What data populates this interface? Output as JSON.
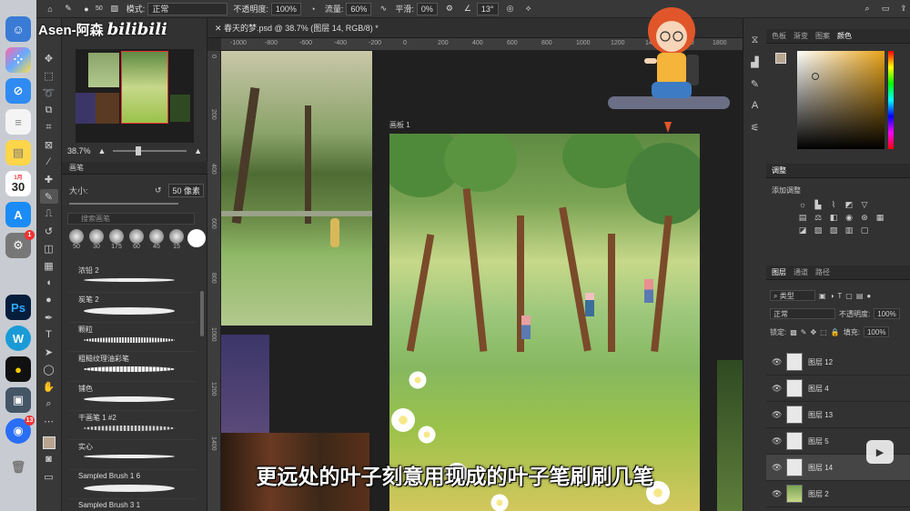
{
  "watermark": {
    "name": "Asen-阿森",
    "logo": "bilibili"
  },
  "options_bar": {
    "mode_label": "模式:",
    "mode_value": "正常",
    "opacity_label": "不透明度:",
    "opacity_value": "100%",
    "flow_label": "流量:",
    "flow_value": "60%",
    "smooth_label": "平滑:",
    "smooth_value": "0%",
    "angle_value": "13°",
    "brush_size": "50"
  },
  "document": {
    "tab_title": "春天的梦.psd @ 38.7% (图层 14, RGB/8) *",
    "artboard_label": "画板 1"
  },
  "ruler": {
    "top": [
      "-1000",
      "-800",
      "-600",
      "-400",
      "-200",
      "0",
      "200",
      "400",
      "600",
      "800",
      "1000",
      "1200",
      "1400",
      "1600",
      "1800"
    ],
    "left": [
      "0",
      "200",
      "400",
      "600",
      "800",
      "1000",
      "1200",
      "1400"
    ]
  },
  "navigator": {
    "zoom": "38.7%"
  },
  "brush_panel": {
    "tab": "画笔",
    "size_label": "大小:",
    "size_value": "50 像素",
    "search_placeholder": "搜索画笔",
    "recent_sizes": [
      "50",
      "30",
      "175",
      "60",
      "45",
      "15"
    ],
    "brushes": [
      "浓铅 2",
      "炭笔 2",
      "颗粒",
      "粗糙纹理油彩笔",
      "铺色",
      "干画笔 1 #2",
      "实心",
      "Sampled Brush 1 6",
      "Sampled Brush 3 1"
    ]
  },
  "dock": {
    "calendar_month": "1月",
    "calendar_day": "30",
    "badges": [
      "1",
      "13"
    ]
  },
  "color_panel": {
    "tabs": [
      "色板",
      "渐变",
      "图案",
      "颜色"
    ],
    "active": "颜色",
    "fg_color": "#b8a58f"
  },
  "adjust_panel": {
    "tab": "调整",
    "add_label": "添加调整"
  },
  "layers_panel": {
    "tabs": [
      "图层",
      "通道",
      "路径"
    ],
    "filter_label": "类型",
    "blend_mode": "正常",
    "opacity_label": "不透明度:",
    "opacity_value": "100%",
    "lock_label": "锁定:",
    "fill_label": "填充:",
    "fill_value": "100%",
    "layers": [
      {
        "name": "图层 12",
        "selected": false
      },
      {
        "name": "图层 4",
        "selected": false
      },
      {
        "name": "图层 13",
        "selected": false
      },
      {
        "name": "图层 5",
        "selected": false
      },
      {
        "name": "图层 14",
        "selected": true
      },
      {
        "name": "图层 2",
        "selected": false
      }
    ]
  },
  "subtitle": "更远处的叶子刻意用现成的叶子笔刷刷几笔"
}
